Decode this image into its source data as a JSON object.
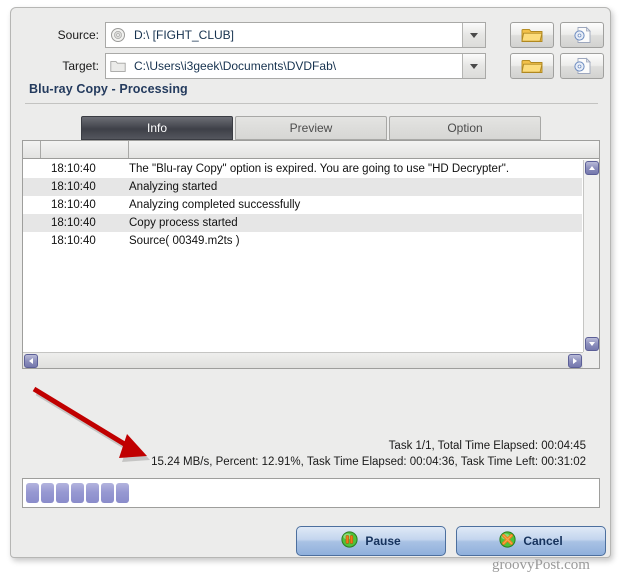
{
  "fields": {
    "source": {
      "label": "Source:",
      "value": "D:\\ [FIGHT_CLUB]",
      "icon": "disc-icon",
      "browse_icon": "folder-icon",
      "disc_icon": "disc-file-icon"
    },
    "target": {
      "label": "Target:",
      "value": "C:\\Users\\i3geek\\Documents\\DVDFab\\",
      "icon": "folder-icon",
      "browse_icon": "folder-icon",
      "disc_icon": "disc-file-icon"
    }
  },
  "section": {
    "title": "Blu-ray Copy  -  Processing"
  },
  "tabs": [
    {
      "label": "Info",
      "active": true
    },
    {
      "label": "Preview",
      "active": false
    },
    {
      "label": "Option",
      "active": false
    }
  ],
  "log": {
    "columns": [
      "",
      "",
      ""
    ],
    "rows": [
      {
        "time": "18:10:40",
        "message": "The \"Blu-ray Copy\" option is expired. You are going to use \"HD Decrypter\"."
      },
      {
        "time": "18:10:40",
        "message": "Analyzing started"
      },
      {
        "time": "18:10:40",
        "message": "Analyzing completed successfully"
      },
      {
        "time": "18:10:40",
        "message": "Copy process started"
      },
      {
        "time": "18:10:40",
        "message": "Source( 00349.m2ts )"
      }
    ]
  },
  "status": {
    "line1": "Task 1/1,  Total Time Elapsed: 00:04:45",
    "line2": "15.24 MB/s,  Percent: 12.91%,  Task Time Elapsed: 00:04:36,  Task Time Left: 00:31:02"
  },
  "progress": {
    "percent": "12.91%",
    "chunks": 7,
    "chunk_color": "#9799d2"
  },
  "buttons": {
    "pause": {
      "label": "Pause",
      "icon": "pause-circle-icon"
    },
    "cancel": {
      "label": "Cancel",
      "icon": "cancel-circle-icon"
    }
  },
  "annotation": {
    "type": "arrow",
    "color": "#c00000"
  },
  "watermark": {
    "text": "groovyPost.com"
  }
}
